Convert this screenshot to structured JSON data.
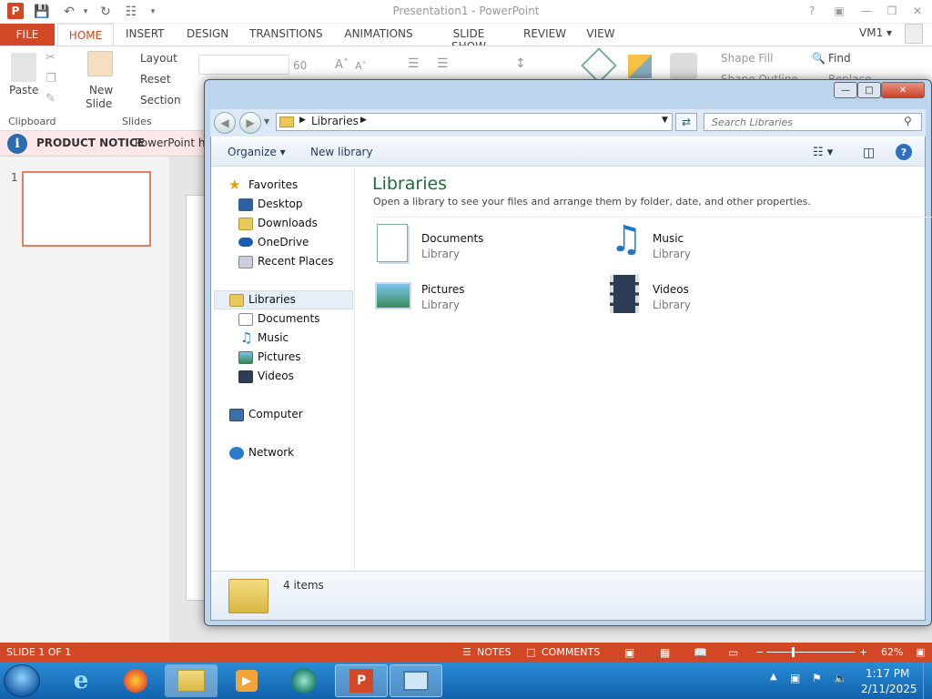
{
  "powerpoint": {
    "window_title": "Presentation1 - PowerPoint",
    "tabs": [
      "FILE",
      "HOME",
      "INSERT",
      "DESIGN",
      "TRANSITIONS",
      "ANIMATIONS",
      "SLIDE SHOW",
      "REVIEW",
      "VIEW"
    ],
    "user": "VM1",
    "ribbon": {
      "paste": "Paste",
      "new_slide_1": "New",
      "new_slide_2": "Slide",
      "layout": "Layout",
      "reset": "Reset",
      "section": "Section",
      "font_size": "60",
      "shape_fill": "Shape Fill",
      "shape_outline": "Shape Outline",
      "find": "Find",
      "replace": "Replace",
      "group_clipboard": "Clipboard",
      "group_slides": "Slides"
    },
    "notice": {
      "title": "PRODUCT NOTICE",
      "text": "PowerPoint ha"
    },
    "slide_number": "1",
    "status": {
      "slide": "SLIDE 1 OF 1",
      "notes": "NOTES",
      "comments": "COMMENTS",
      "zoom": "62%"
    },
    "accent": "#d24726"
  },
  "explorer": {
    "address": "Libraries",
    "search_placeholder": "Search Libraries",
    "toolbar": {
      "organize": "Organize",
      "new_library": "New library"
    },
    "nav": {
      "favorites": "Favorites",
      "desktop": "Desktop",
      "downloads": "Downloads",
      "onedrive": "OneDrive",
      "recent": "Recent Places",
      "libraries": "Libraries",
      "documents": "Documents",
      "music": "Music",
      "pictures": "Pictures",
      "videos": "Videos",
      "computer": "Computer",
      "network": "Network"
    },
    "content": {
      "title": "Libraries",
      "subtitle": "Open a library to see your files and arrange them by folder, date, and other properties.",
      "libraries": [
        {
          "name": "Documents",
          "type": "Library"
        },
        {
          "name": "Music",
          "type": "Library"
        },
        {
          "name": "Pictures",
          "type": "Library"
        },
        {
          "name": "Videos",
          "type": "Library"
        }
      ]
    },
    "status": "4 items"
  },
  "taskbar": {
    "time": "1:17 PM",
    "date": "2/11/2025"
  }
}
